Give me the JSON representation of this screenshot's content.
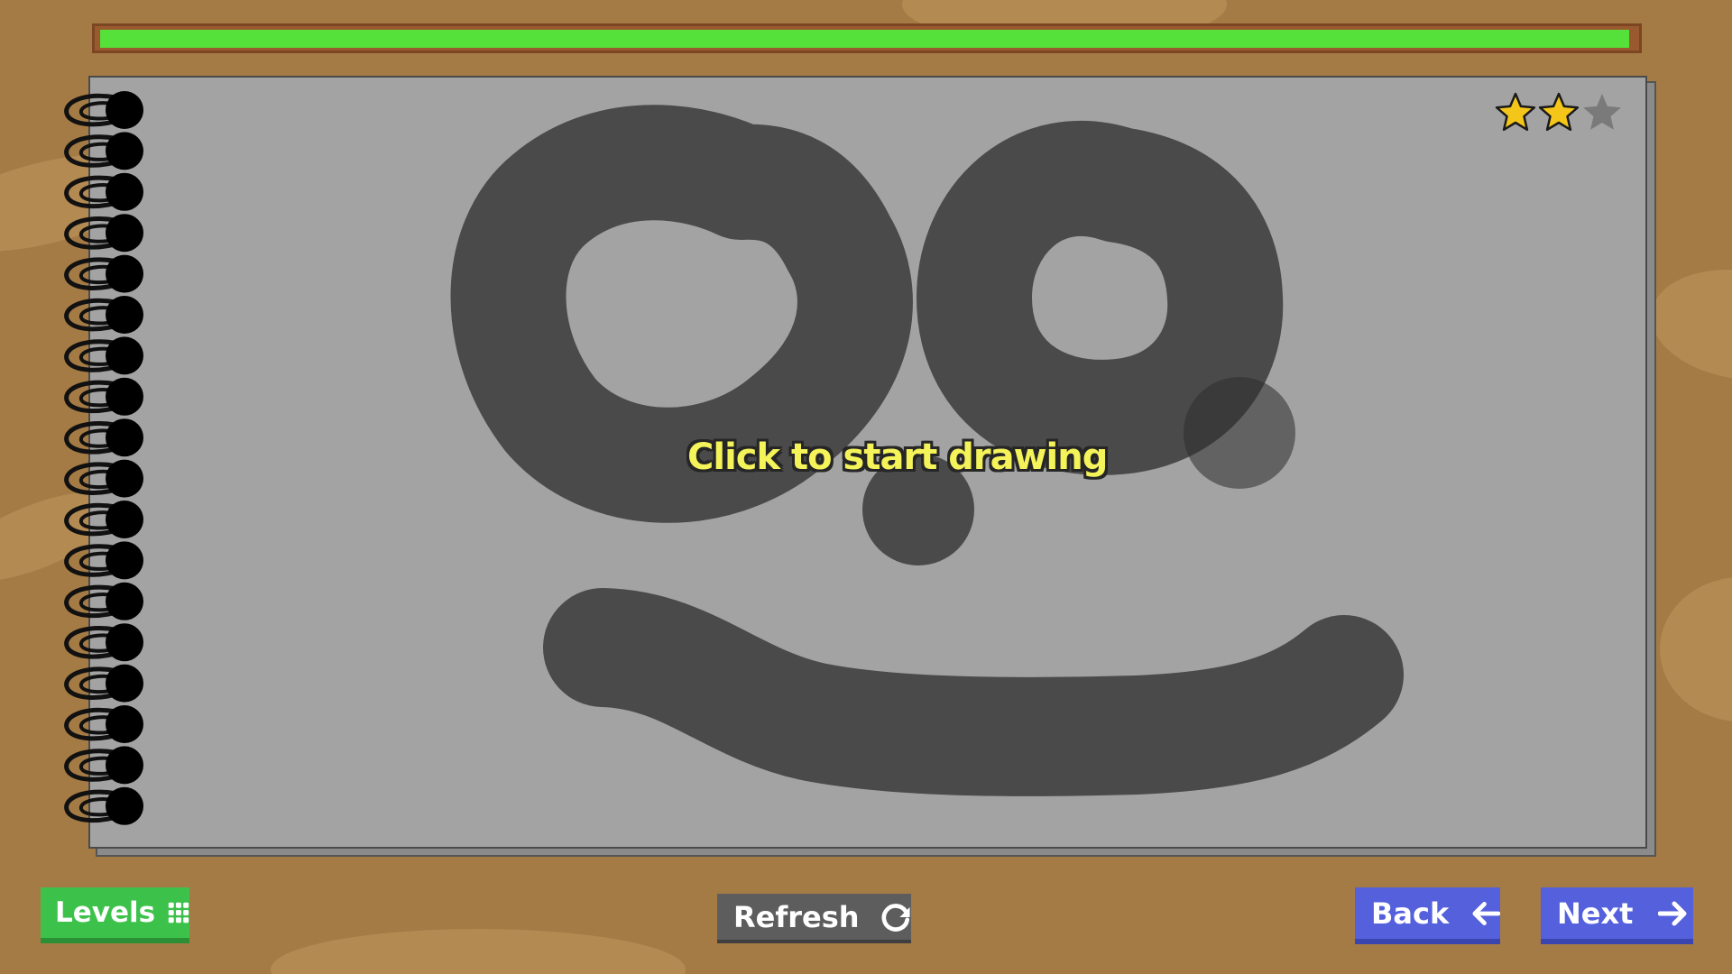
{
  "progress": {
    "fraction": 0.997,
    "color": "#55e03a"
  },
  "stars": {
    "earned": 2,
    "total": 3,
    "icon": "star-icon",
    "filled_color": "#f5c61a",
    "empty_color": "#7a7a7a"
  },
  "canvas": {
    "hint": "Click to start drawing",
    "ink_color": "#4a4a4a"
  },
  "buttons": {
    "levels": {
      "label": "Levels",
      "icon": "grid-icon"
    },
    "refresh": {
      "label": "Refresh",
      "icon": "refresh-icon"
    },
    "back": {
      "label": "Back",
      "icon": "arrow-left-icon"
    },
    "next": {
      "label": "Next",
      "icon": "arrow-right-icon"
    }
  },
  "colors": {
    "background": "#a57b45",
    "page": "#a3a3a3",
    "primary_button": "#5560dc",
    "levels_button": "#3cc24a",
    "refresh_button": "#5d5d5d"
  }
}
